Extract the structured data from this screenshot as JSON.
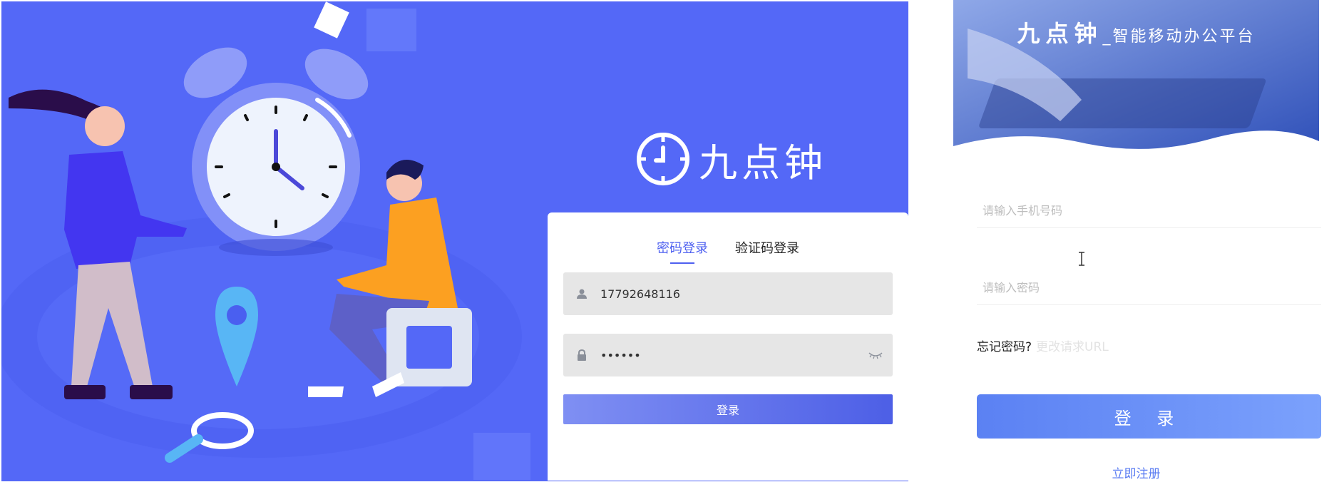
{
  "desktop": {
    "brand": {
      "name": "九点钟"
    },
    "tabs": [
      {
        "label": "密码登录",
        "active": true
      },
      {
        "label": "验证码登录",
        "active": false
      }
    ],
    "phone": {
      "value": "17792648116",
      "icon": "user-icon"
    },
    "password": {
      "value": "••••••",
      "icon": "lock-icon",
      "toggle_icon": "eye-closed-icon"
    },
    "login_label": "登录",
    "colors": {
      "background": "#5468f7",
      "accent": "#4e60f0"
    }
  },
  "mobile": {
    "banner": {
      "brand": "九点钟",
      "separator": "_",
      "subtitle": "智能移动办公平台"
    },
    "phone_placeholder": "请输入手机号码",
    "password_placeholder": "请输入密码",
    "forgot_label": "忘记密码?",
    "forgot_url_text": "更改请求URL",
    "login_label": "登 录",
    "register_label": "立即注册",
    "colors": {
      "button": "#6a8ff7",
      "link": "#5a7cf2"
    }
  }
}
